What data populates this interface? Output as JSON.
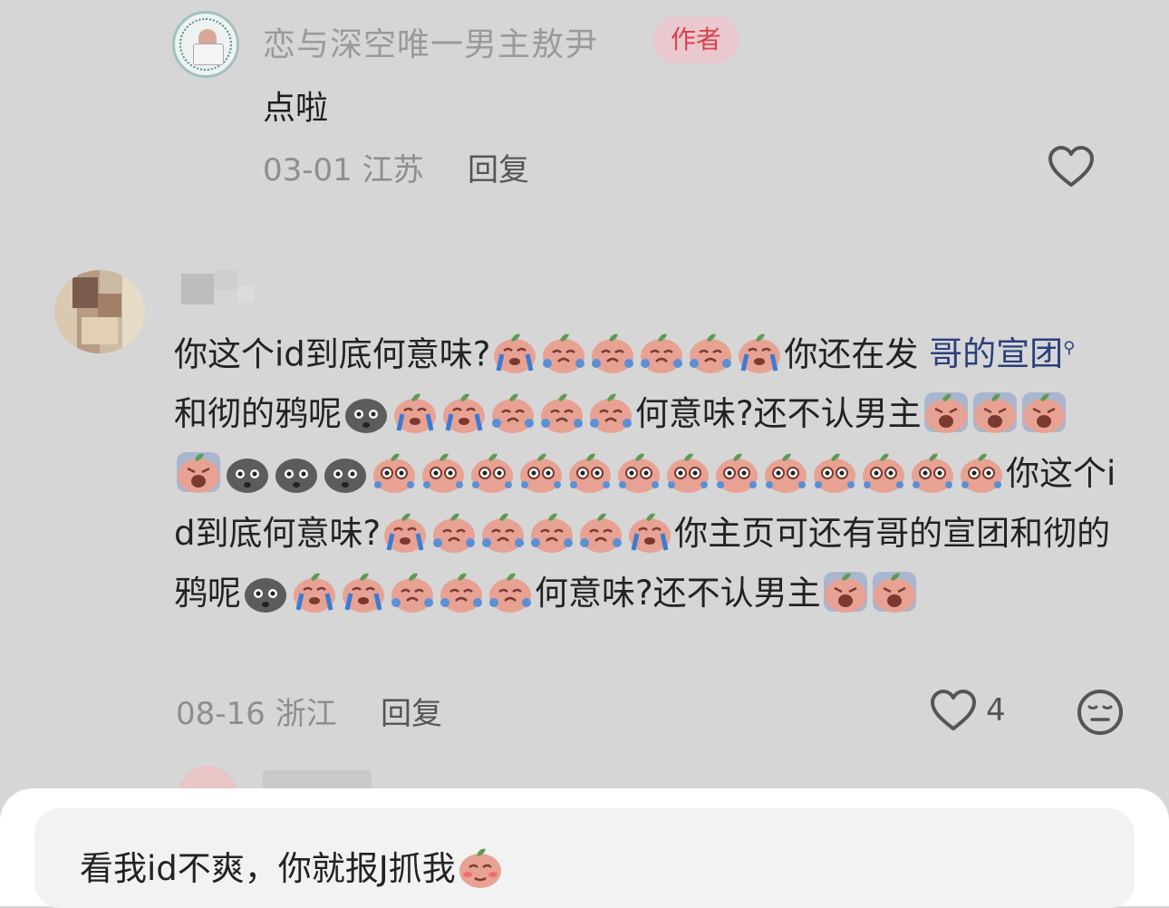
{
  "reply": {
    "username": "恋与深空唯一男主敖尹",
    "badge": "作者",
    "text": "点啦",
    "date_location": "03-01 江苏",
    "reply_label": "回复"
  },
  "comment": {
    "line1_a": "你这个id到底何意味?",
    "line1_b": "你还在发 ",
    "link_text_1": "哥的宣",
    "link_text_2": "团",
    "line2_a": " 和彻的鸦呢",
    "line2_b": "何意味?还不认男主",
    "line4_a": "你这个id到底何意味?",
    "line4_b": "你主页可还有哥",
    "line5_a": "的宣团和彻的鸦呢",
    "line5_b": "何意味?还不认男主",
    "date_location": "08-16 浙江",
    "reply_label": "回复",
    "likes": "4"
  },
  "input": {
    "text": "看我id不爽，你就报J抓我"
  },
  "colors": {
    "background": "#d6d6d6",
    "author_badge_bg": "#e9c9ce",
    "author_badge_text": "#d9434e",
    "link": "#2b3f7c"
  },
  "icons": [
    "heart-outline-icon",
    "meh-face-icon",
    "search-icon",
    "crying-peach-emoji",
    "sobbing-peach-emoji",
    "screaming-peach-emoji",
    "shocked-rock-emoji",
    "teary-peach-emoji",
    "blushing-peach-emoji"
  ]
}
